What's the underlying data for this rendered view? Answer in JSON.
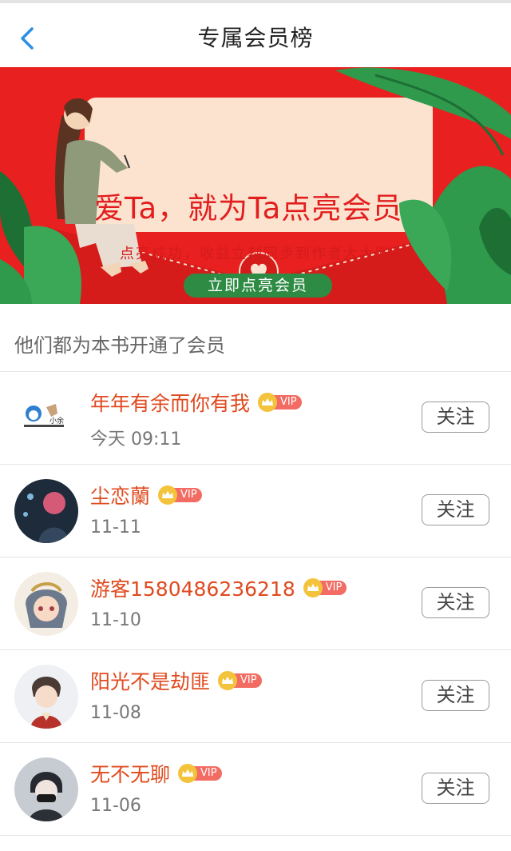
{
  "header": {
    "title": "专属会员榜",
    "back_icon": "chevron-left-icon"
  },
  "banner": {
    "headline": "爱Ta，就为Ta点亮会员",
    "subtitle": "点亮成功，收益立刻同步到作者大大账户",
    "cta_label": "立即点亮会员",
    "colors": {
      "background": "#e8201f",
      "card": "#fbe3cf",
      "cta": "#2e8b43"
    }
  },
  "section": {
    "title": "他们都为本书开通了会员"
  },
  "members": [
    {
      "name": "年年有余而你有我",
      "date": "今天 09:11",
      "vip": "VIP",
      "follow_label": "关注"
    },
    {
      "name": "尘恋蘭",
      "date": "11-11",
      "vip": "VIP",
      "follow_label": "关注"
    },
    {
      "name": "游客1580486236218",
      "date": "11-10",
      "vip": "VIP",
      "follow_label": "关注"
    },
    {
      "name": "阳光不是劫匪",
      "date": "11-08",
      "vip": "VIP",
      "follow_label": "关注"
    },
    {
      "name": "无不无聊",
      "date": "11-06",
      "vip": "VIP",
      "follow_label": "关注"
    }
  ],
  "colors": {
    "accent_name": "#e04a1f",
    "back_icon": "#2a8ee6",
    "vip_tag": "#f26c63",
    "crown": "#f3c33b"
  }
}
